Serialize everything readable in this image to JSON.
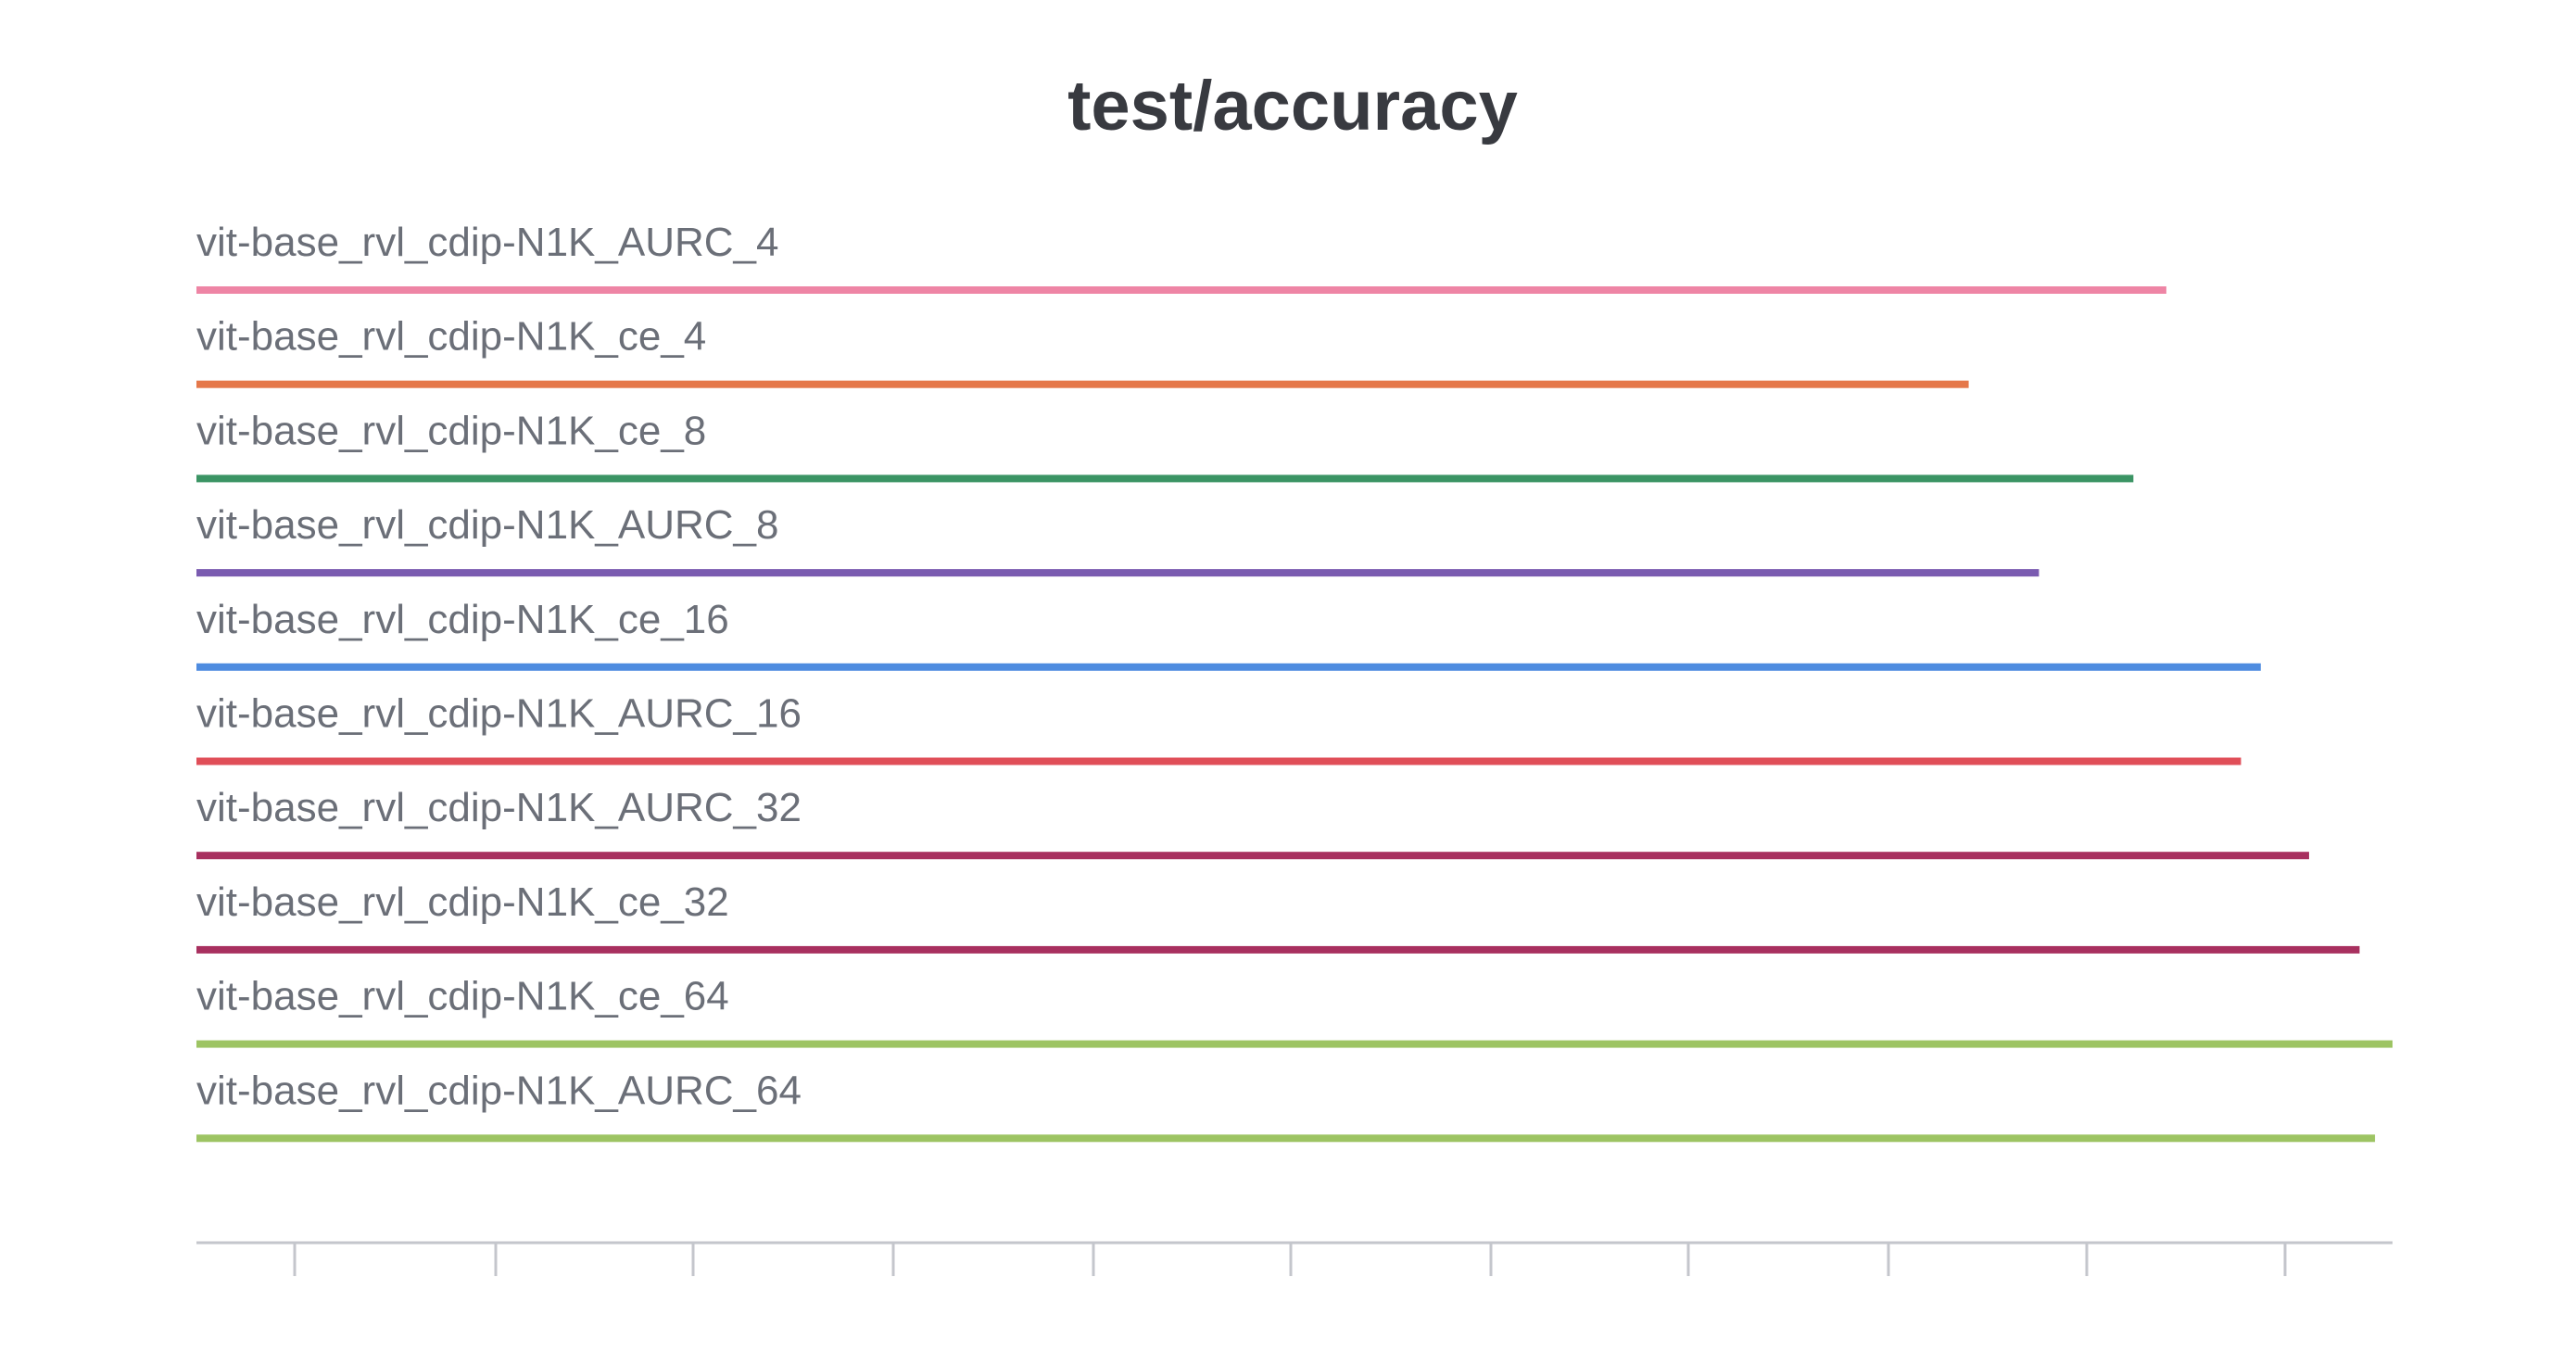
{
  "chart_data": {
    "type": "bar",
    "orientation": "horizontal",
    "title": "test/accuracy",
    "xlabel": "",
    "ylabel": "",
    "grid": false,
    "legend": "none",
    "x_ticks_labeled": false,
    "series": [
      {
        "name": "vit-base_rvl_cdip-N1K_AURC_4",
        "value": 0.897,
        "color": "#ee85a5"
      },
      {
        "name": "vit-base_rvl_cdip-N1K_ce_4",
        "value": 0.807,
        "color": "#e5784a"
      },
      {
        "name": "vit-base_rvl_cdip-N1K_ce_8",
        "value": 0.882,
        "color": "#3b9464"
      },
      {
        "name": "vit-base_rvl_cdip-N1K_AURC_8",
        "value": 0.839,
        "color": "#7a5bb0"
      },
      {
        "name": "vit-base_rvl_cdip-N1K_ce_16",
        "value": 0.94,
        "color": "#4e8ce0"
      },
      {
        "name": "vit-base_rvl_cdip-N1K_AURC_16",
        "value": 0.931,
        "color": "#e04e58"
      },
      {
        "name": "vit-base_rvl_cdip-N1K_AURC_32",
        "value": 0.962,
        "color": "#a8305f"
      },
      {
        "name": "vit-base_rvl_cdip-N1K_ce_32",
        "value": 0.985,
        "color": "#a8305f"
      },
      {
        "name": "vit-base_rvl_cdip-N1K_ce_64",
        "value": 1.0,
        "color": "#9dc463"
      },
      {
        "name": "vit-base_rvl_cdip-N1K_AURC_64",
        "value": 0.992,
        "color": "#9dc463"
      }
    ],
    "xlim": [
      0,
      1.0
    ]
  }
}
